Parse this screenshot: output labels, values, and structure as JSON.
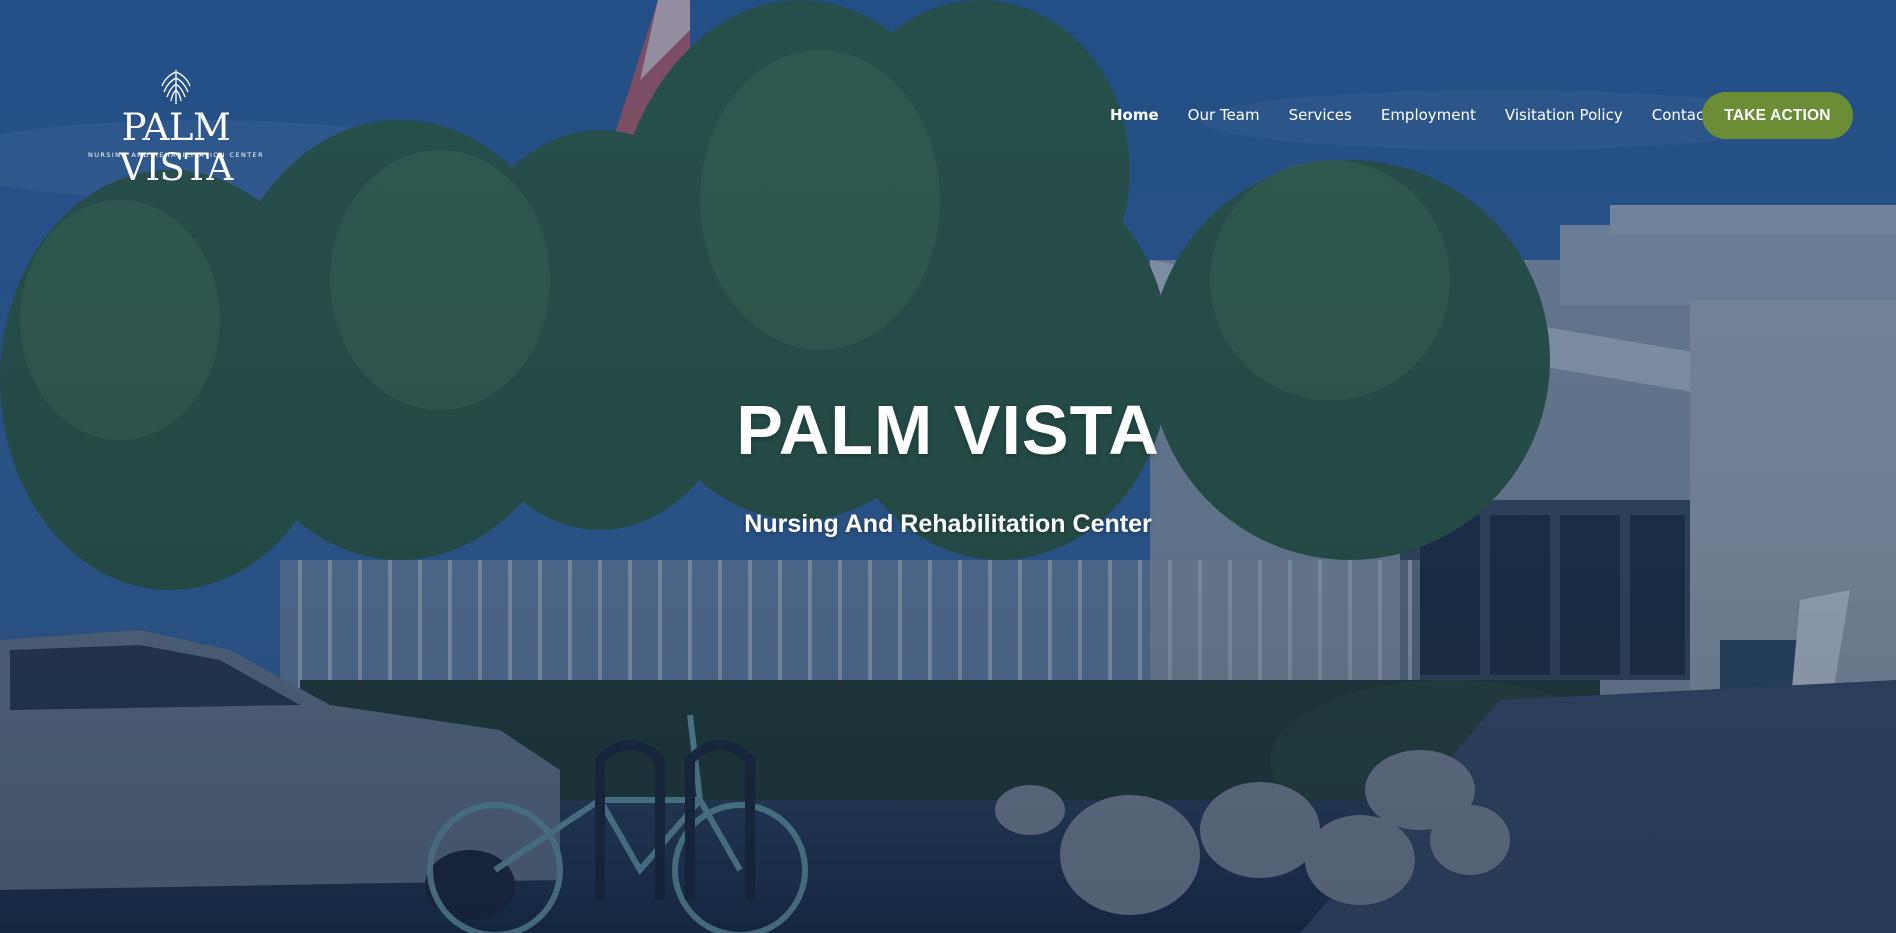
{
  "logo": {
    "name": "PALM VISTA",
    "tagline": "NURSING AND REHABILITATION CENTER",
    "icon": "palm-leaf-icon"
  },
  "nav": {
    "items": [
      {
        "label": "Home",
        "active": true
      },
      {
        "label": "Our Team",
        "active": false
      },
      {
        "label": "Services",
        "active": false
      },
      {
        "label": "Employment",
        "active": false
      },
      {
        "label": "Visitation Policy",
        "active": false
      },
      {
        "label": "Contact",
        "active": false
      }
    ],
    "cta_label": "TAKE ACTION"
  },
  "hero": {
    "title": "PALM VISTA",
    "subtitle": "Nursing And Rehabilitation Center"
  },
  "colors": {
    "overlay": "#1f4f8a",
    "cta": "#6a8d36",
    "text": "#ffffff"
  }
}
